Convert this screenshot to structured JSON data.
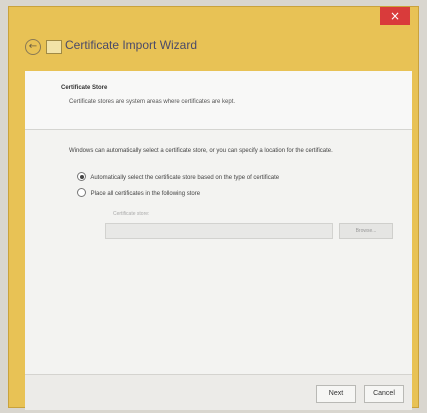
{
  "window": {
    "close_label": "×"
  },
  "titlebar": {
    "back_label": "←",
    "title": "Certificate Import Wizard"
  },
  "header": {
    "title": "Certificate Store",
    "description": "Certificate stores are system areas where certificates are kept."
  },
  "main": {
    "intro": "Windows can automatically select a certificate store, or you can specify a location for the certificate.",
    "options": [
      {
        "label": "Automatically select the certificate store based on the type of certificate",
        "selected": true
      },
      {
        "label": "Place all certificates in the following store",
        "selected": false
      }
    ],
    "store_label": "Certificate store:",
    "store_value": "",
    "browse_label": "Browse..."
  },
  "footer": {
    "next_label": "Next",
    "cancel_label": "Cancel"
  }
}
